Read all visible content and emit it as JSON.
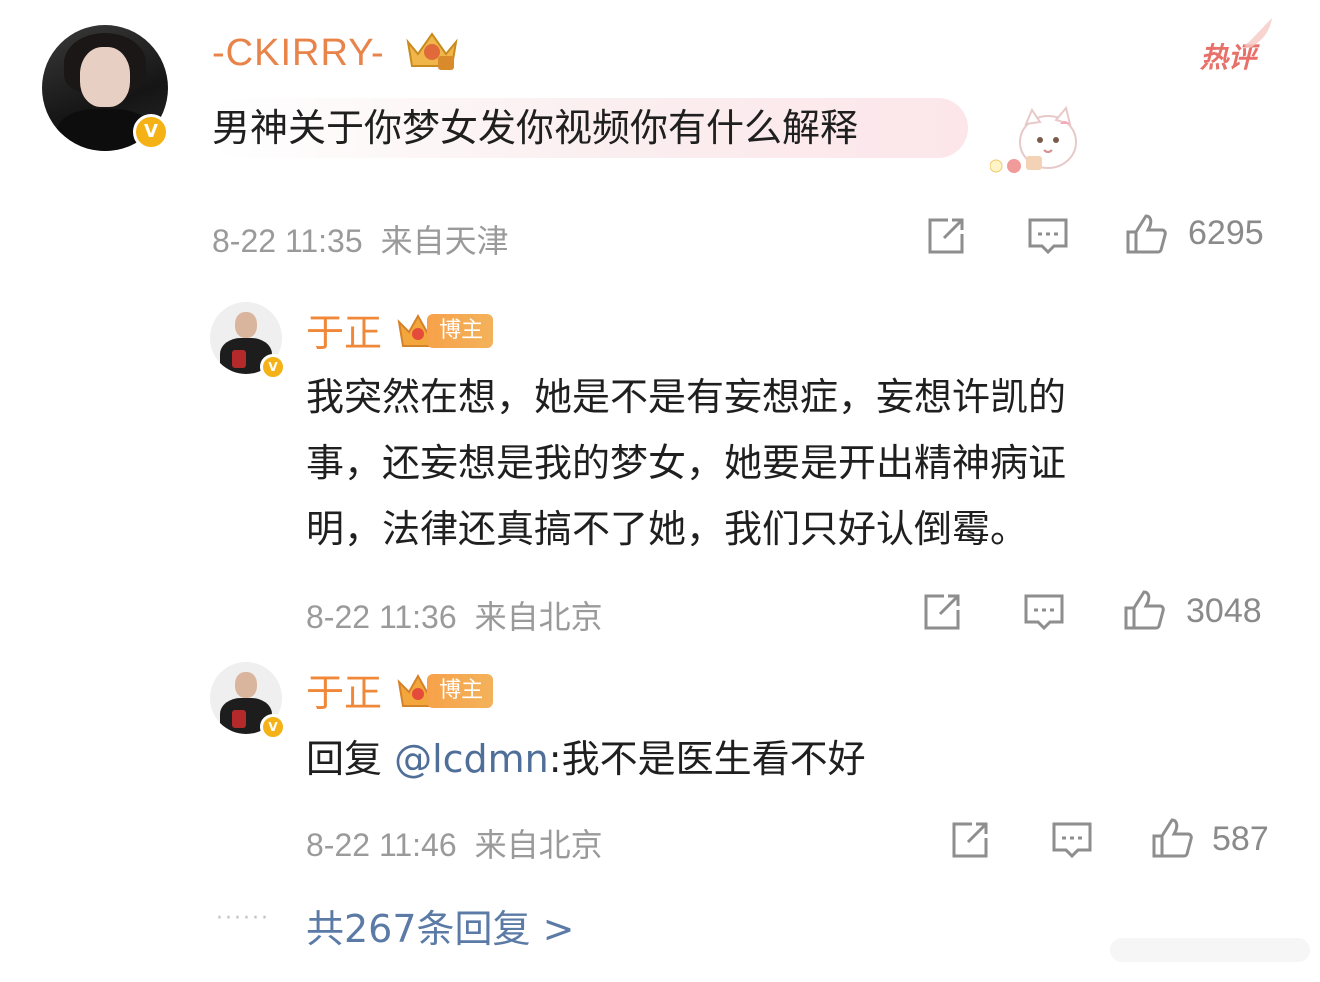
{
  "hot_label": "热评",
  "main_comment": {
    "username": "-CKIRRY-",
    "text": "男神关于你梦女发你视频你有什么解释",
    "time": "8-22 11:35",
    "location": "来自天津",
    "likes": "6295"
  },
  "replies": [
    {
      "username": "于正",
      "badge": "博主",
      "text": "我突然在想，她是不是有妄想症，妄想许凯的事，还妄想是我的梦女，她要是开出精神病证明，法律还真搞不了她，我们只好认倒霉。",
      "line1": "我突然在想，她是不是有妄想症，妄想许凯的",
      "line2": "事，还妄想是我的梦女，她要是开出精神病证",
      "line3": "明，法律还真搞不了她，我们只好认倒霉。",
      "time": "8-22 11:36",
      "location": "来自北京",
      "likes": "3048"
    },
    {
      "username": "于正",
      "badge": "博主",
      "reply_prefix": "回复 ",
      "mention": "@lcdmn",
      "text": ":我不是医生看不好",
      "time": "8-22 11:46",
      "location": "来自北京",
      "likes": "587"
    }
  ],
  "more_replies": "共267条回复 >",
  "more_dots": "······",
  "colors": {
    "username_orange": "#f0883a",
    "meta_gray": "#9a9a9a",
    "link_blue": "#5b7aa6",
    "verified_gold": "#f5b217"
  },
  "icons": [
    "share-icon",
    "comment-icon",
    "like-icon",
    "crown-icon",
    "verified-icon"
  ]
}
